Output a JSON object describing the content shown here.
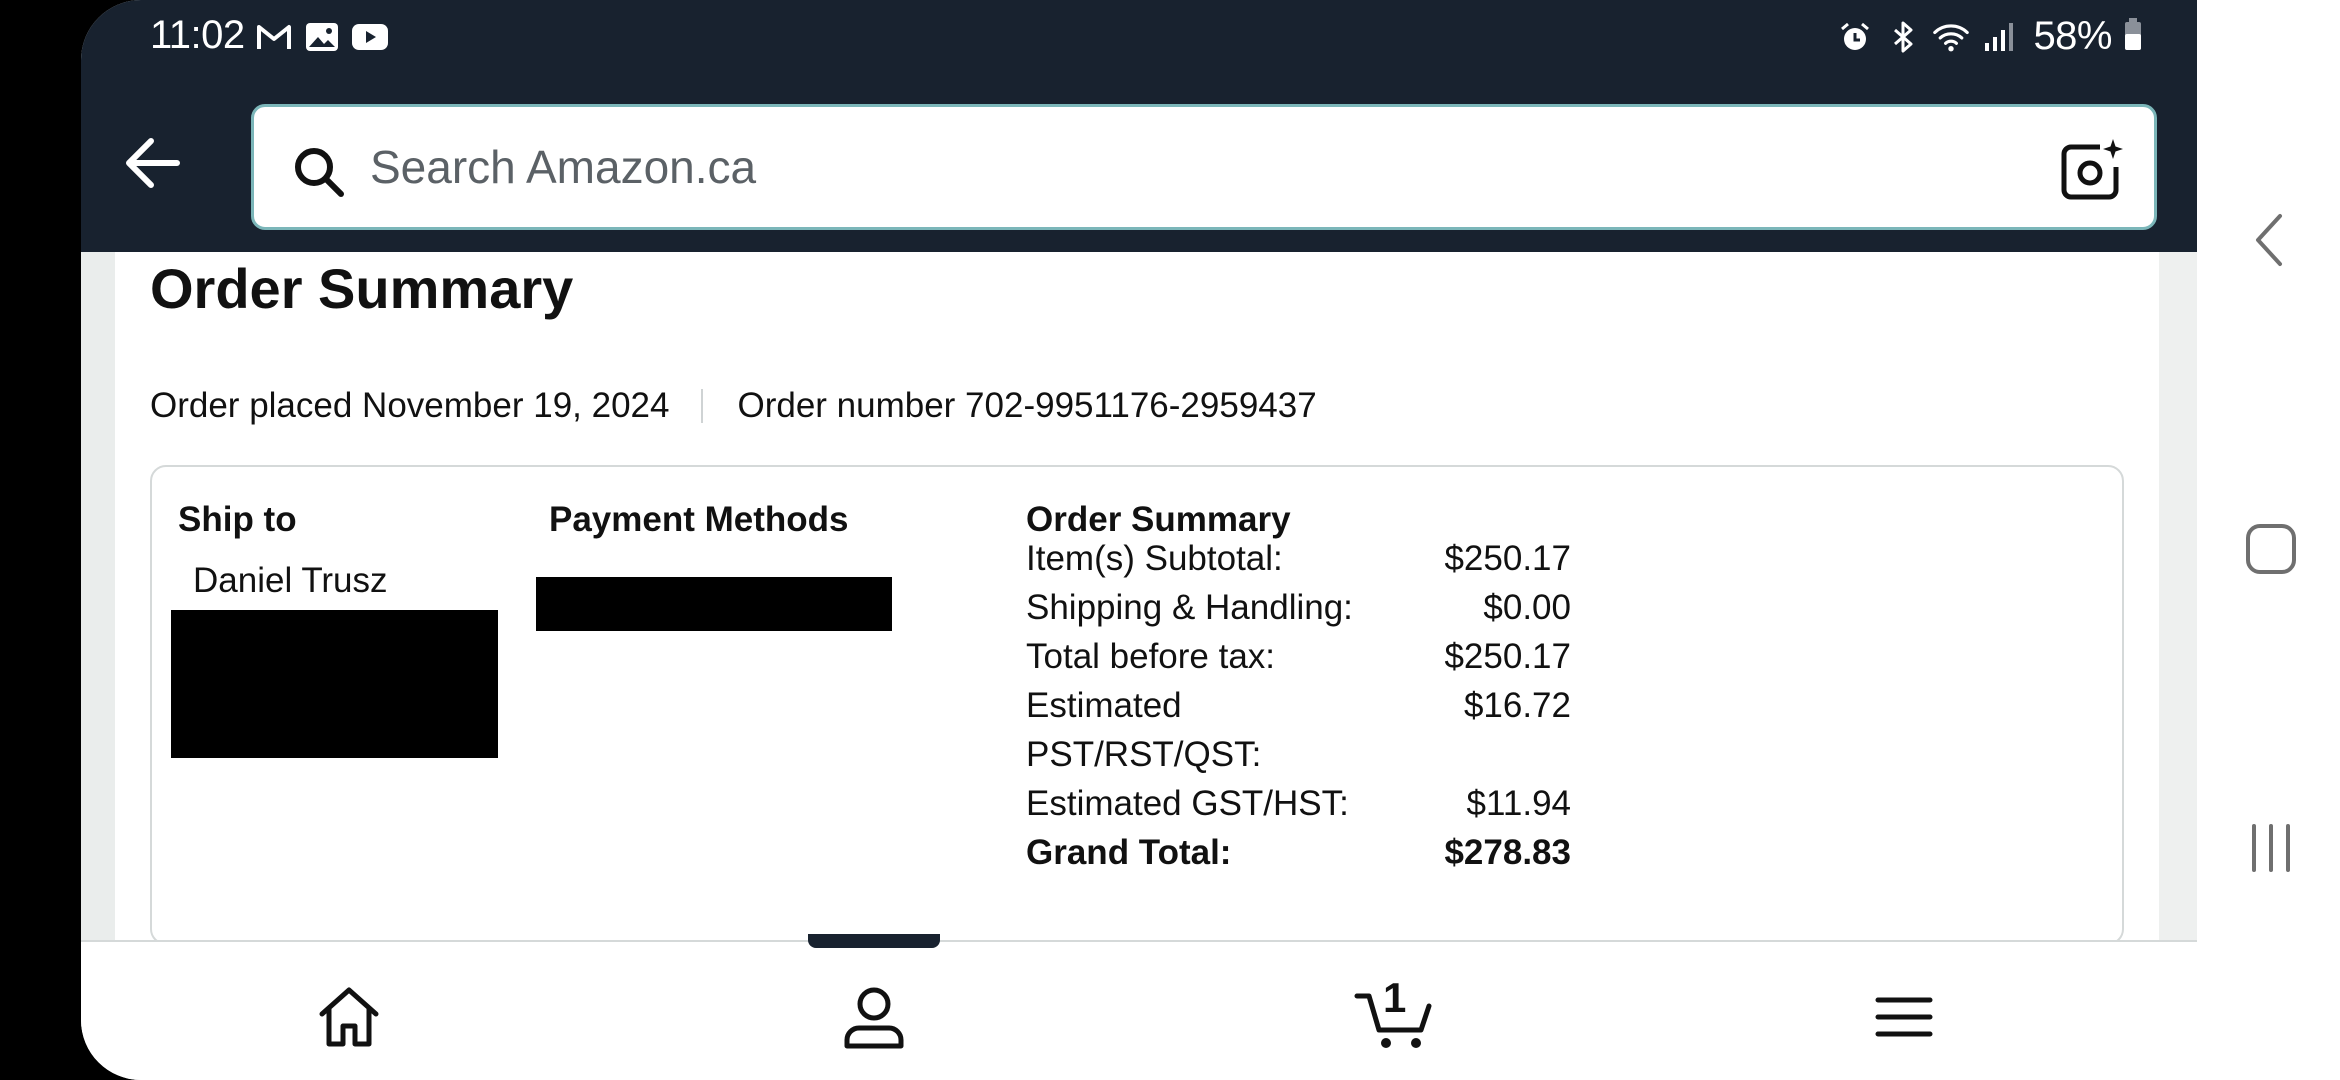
{
  "status_bar": {
    "time": "11:02",
    "notification_icons": [
      "gmail-icon",
      "gallery-icon",
      "youtube-icon"
    ],
    "system_icons": [
      "alarm-icon",
      "bluetooth-icon",
      "wifi-icon",
      "signal-icon"
    ],
    "battery": "58%"
  },
  "search": {
    "placeholder": "Search Amazon.ca"
  },
  "page": {
    "title": "Order Summary",
    "order_placed": "Order placed November 19, 2024",
    "order_number": "Order number 702-9951176-2959437"
  },
  "ship_to": {
    "heading": "Ship to",
    "name": "Daniel Trusz"
  },
  "payment": {
    "heading": "Payment Methods"
  },
  "order_summary": {
    "heading": "Order Summary",
    "rows": [
      {
        "label": "Item(s) Subtotal:",
        "value": "$250.17"
      },
      {
        "label": "Shipping & Handling:",
        "value": "$0.00"
      },
      {
        "label": "Total before tax:",
        "value": "$250.17"
      },
      {
        "label": "Estimated PST/RST/QST:",
        "value": "$16.72"
      },
      {
        "label": "Estimated GST/HST:",
        "value": "$11.94"
      }
    ],
    "grand_total": {
      "label": "Grand Total:",
      "value": "$278.83"
    }
  },
  "bottom_nav": {
    "items": [
      "home-icon",
      "account-icon",
      "cart-icon",
      "menu-icon"
    ],
    "cart_count": "1"
  },
  "colors": {
    "header_bg": "#18222f",
    "search_border": "#7bb6b9",
    "card_border": "#d5d9d9"
  }
}
